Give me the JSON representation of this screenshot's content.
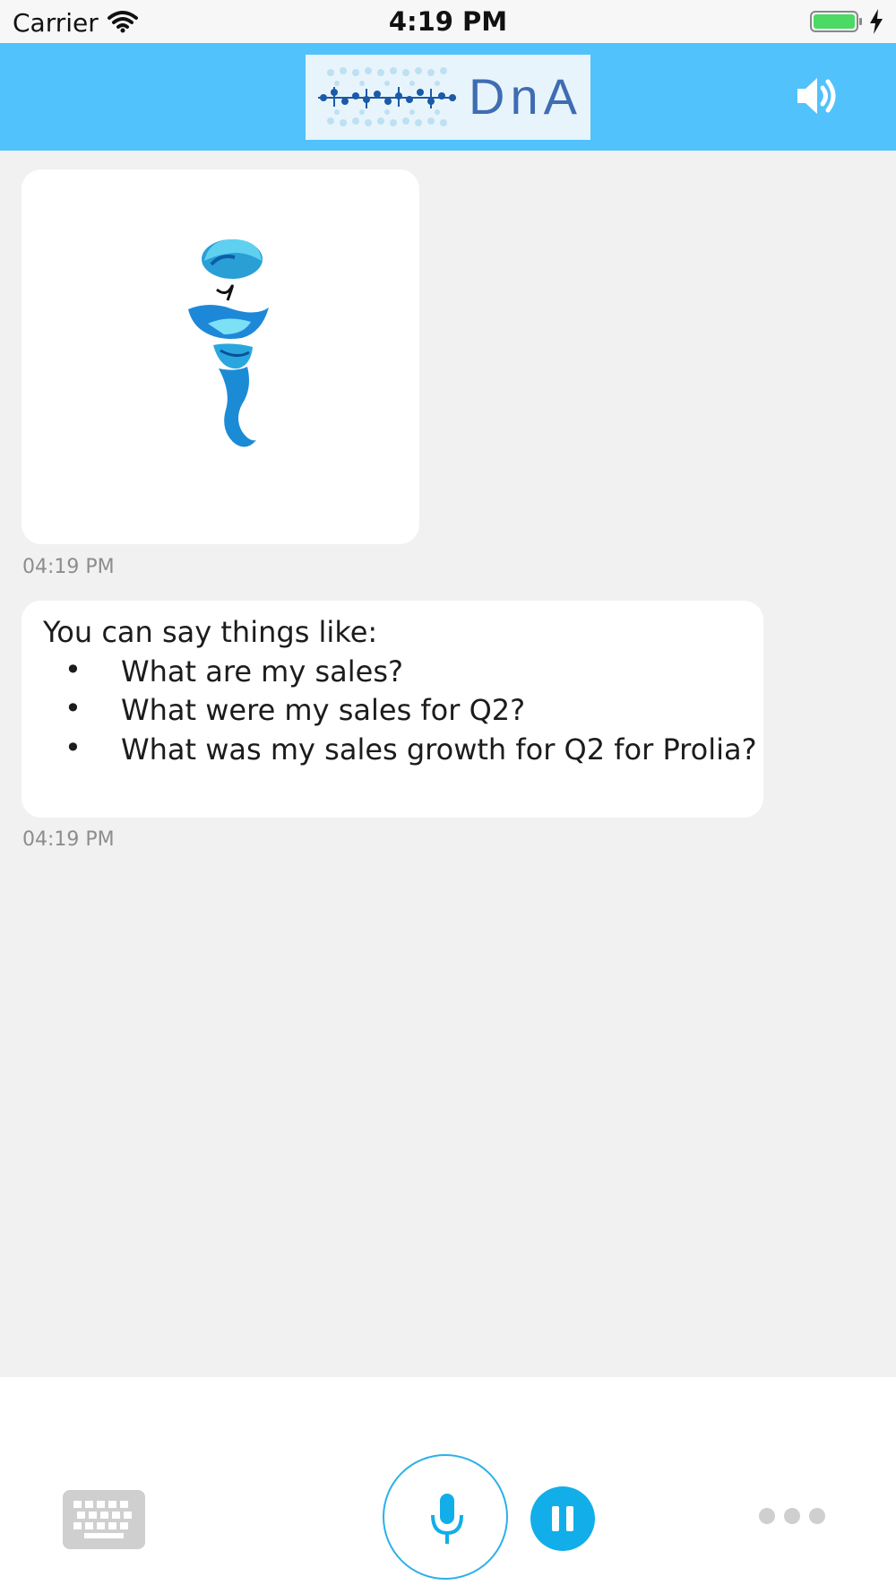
{
  "status_bar": {
    "carrier": "Carrier",
    "time": "4:19 PM",
    "icons": [
      "wifi-icon",
      "battery-icon",
      "charging-bolt-icon"
    ]
  },
  "header": {
    "logo_text": "DnA",
    "background_color": "#51c2fb",
    "right_icon": "speaker-volume-icon"
  },
  "messages": [
    {
      "type": "image",
      "image": "genie-mascot",
      "timestamp": "04:19 PM"
    },
    {
      "type": "text",
      "intro": "You can say things like:",
      "suggestions": [
        "What are my sales?",
        "What were my sales for Q2?",
        "What was my sales growth for Q2 for Prolia?"
      ],
      "bullet": "•",
      "timestamp": "04:19 PM"
    }
  ],
  "bottom_bar": {
    "buttons": [
      "keyboard-icon",
      "microphone-icon",
      "pause-icon",
      "more-icon"
    ],
    "accent_color": "#11aee9"
  }
}
